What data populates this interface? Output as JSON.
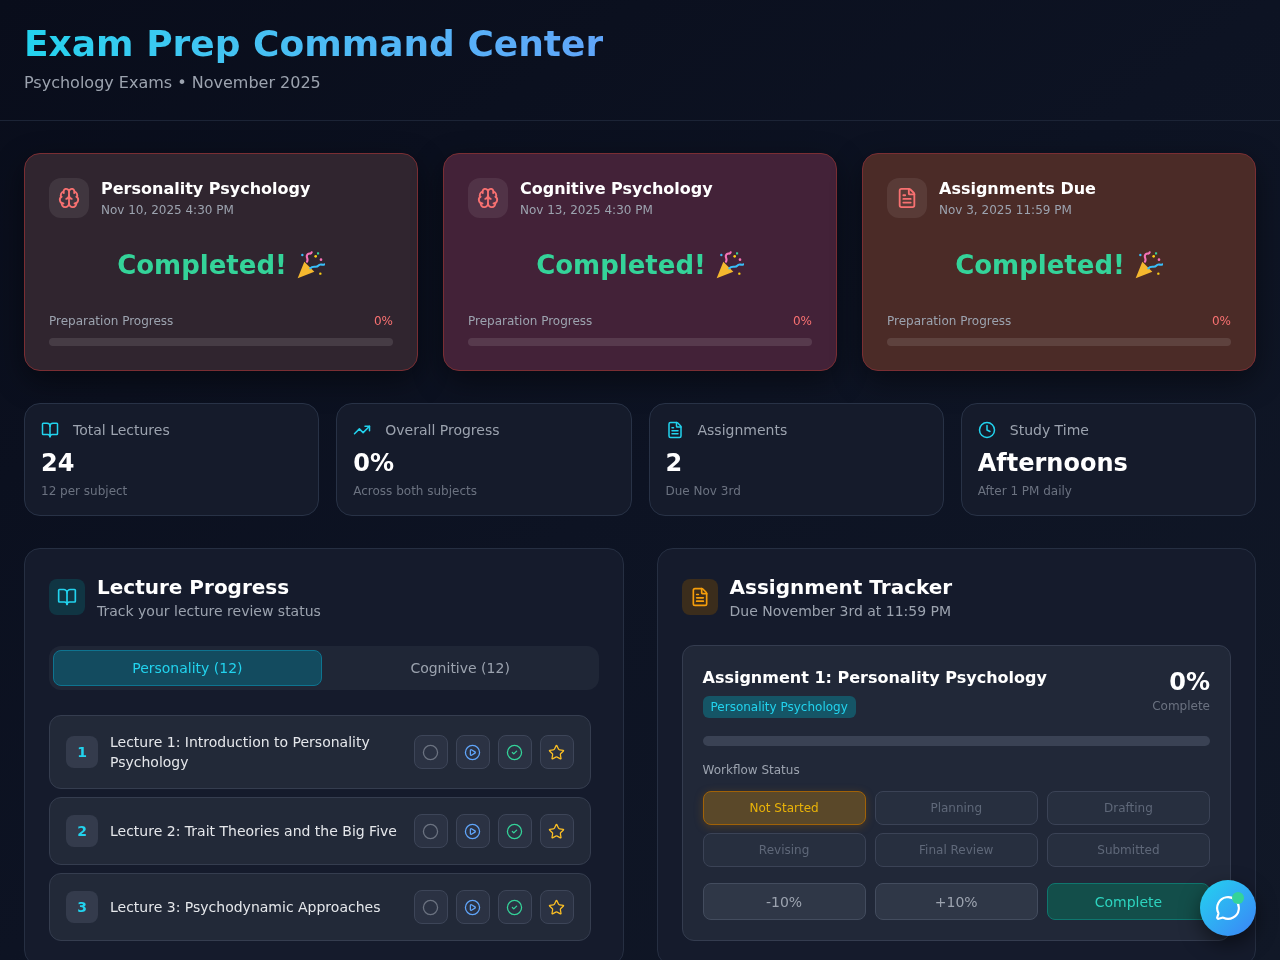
{
  "header": {
    "title": "Exam Prep Command Center",
    "subtitle": "Psychology Exams • November 2025"
  },
  "exam_cards": [
    {
      "kind": "exam",
      "title": "Personality Psychology",
      "date": "Nov 10, 2025 4:30 PM",
      "status": "Completed!",
      "progress_label": "Preparation Progress",
      "progress_value": "0%",
      "level": 0,
      "color": "#30252f"
    },
    {
      "kind": "exam",
      "title": "Cognitive Psychology",
      "date": "Nov 13, 2025 4:30 PM",
      "status": "Completed!",
      "progress_label": "Preparation Progress",
      "progress_value": "0%",
      "level": 0,
      "color": "#432238"
    },
    {
      "kind": "assignment",
      "title": "Assignments Due",
      "date": "Nov 3, 2025 11:59 PM",
      "status": "Completed!",
      "progress_label": "Preparation Progress",
      "progress_value": "0%",
      "level": 0,
      "color": "#4b2b27"
    }
  ],
  "stats": [
    {
      "kind": "lectures",
      "label": "Total Lectures",
      "value": "24",
      "note": "12 per subject"
    },
    {
      "kind": "trend",
      "label": "Overall Progress",
      "value": "0%",
      "note": "Across both subjects"
    },
    {
      "kind": "document",
      "label": "Assignments",
      "value": "2",
      "note": "Due Nov 3rd"
    },
    {
      "kind": "time",
      "label": "Study Time",
      "value": "Afternoons",
      "note": "After 1 PM daily"
    }
  ],
  "lecture_panel": {
    "title": "Lecture Progress",
    "subtitle": "Track your lecture review status",
    "tabs": [
      {
        "label": "Personality (12)",
        "selected": true
      },
      {
        "label": "Cognitive (12)",
        "selected": false
      }
    ],
    "lectures": [
      {
        "number": "1",
        "title": "Lecture 1: Introduction to Personality Psychology"
      },
      {
        "number": "2",
        "title": "Lecture 2: Trait Theories and the Big Five"
      },
      {
        "number": "3",
        "title": "Lecture 3: Psychodynamic Approaches"
      }
    ]
  },
  "assignment_panel": {
    "title": "Assignment Tracker",
    "subtitle": "Due November 3rd at 11:59 PM",
    "assignment": {
      "title": "Assignment 1: Personality Psychology",
      "tag": "Personality Psychology",
      "percent": "0%",
      "percent_caption": "Complete",
      "level": 0,
      "workflow_label": "Workflow Status",
      "statuses": [
        {
          "label": "Not Started",
          "selected": true
        },
        {
          "label": "Planning",
          "selected": false
        },
        {
          "label": "Drafting",
          "selected": false
        },
        {
          "label": "Revising",
          "selected": false
        },
        {
          "label": "Final Review",
          "selected": false
        },
        {
          "label": "Submitted",
          "selected": false
        }
      ],
      "actions": [
        {
          "kind": "decrease",
          "label": "-10%"
        },
        {
          "kind": "increase",
          "label": "+10%"
        },
        {
          "kind": "complete",
          "label": "Complete"
        }
      ]
    }
  },
  "chat_button": {
    "notification": true
  }
}
